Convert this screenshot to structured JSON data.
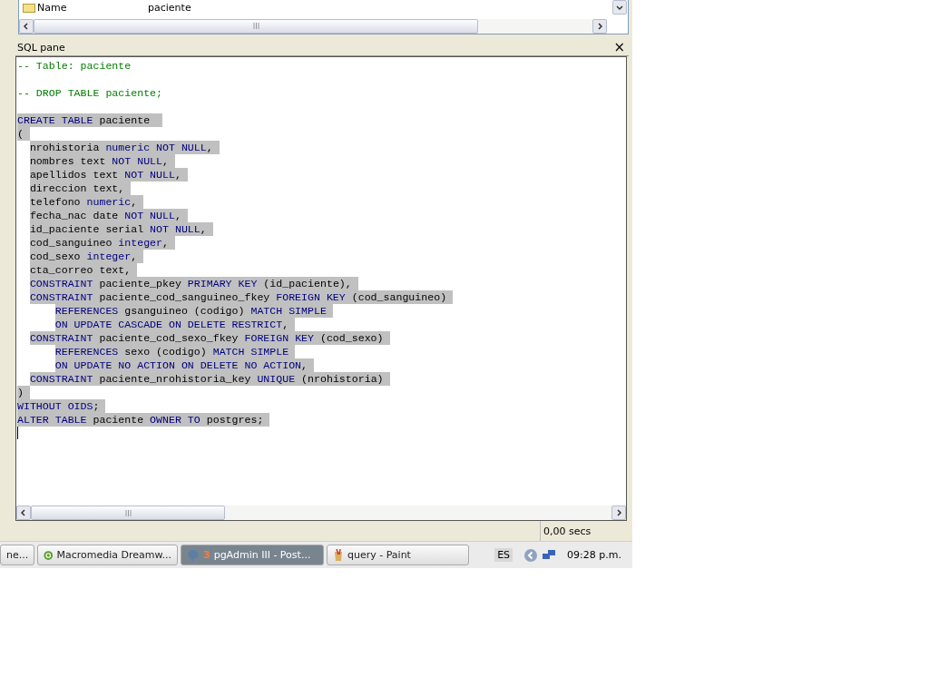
{
  "properties": {
    "rows": [
      {
        "name": "Name",
        "value": "paciente"
      }
    ]
  },
  "sql_pane": {
    "title": "SQL pane",
    "close": "×",
    "lines": [
      {
        "kind": "top",
        "selected": false,
        "segments": [
          {
            "kind": "comment",
            "text": "-- Table: paciente"
          }
        ]
      },
      {
        "kind": "blank",
        "selected": false
      },
      {
        "kind": "top",
        "selected": false,
        "segments": [
          {
            "kind": "comment",
            "text": "-- DROP TABLE paciente;"
          }
        ]
      },
      {
        "kind": "blank",
        "selected": false
      },
      {
        "kind": "top",
        "selected": true,
        "segments": [
          {
            "kind": "keyword",
            "text": "CREATE TABLE"
          },
          {
            "kind": "plain",
            "text": " paciente "
          }
        ]
      },
      {
        "kind": "top",
        "selected": true,
        "segments": [
          {
            "kind": "plain",
            "text": "("
          }
        ]
      },
      {
        "kind": "item",
        "selected": true,
        "segments": [
          {
            "kind": "plain",
            "text": "nrohistoria "
          },
          {
            "kind": "keyword",
            "text": "numeric NOT NULL"
          },
          {
            "kind": "plain",
            "text": ","
          }
        ]
      },
      {
        "kind": "item",
        "selected": true,
        "segments": [
          {
            "kind": "plain",
            "text": "nombres text "
          },
          {
            "kind": "keyword",
            "text": "NOT NULL"
          },
          {
            "kind": "plain",
            "text": ","
          }
        ]
      },
      {
        "kind": "item",
        "selected": true,
        "segments": [
          {
            "kind": "plain",
            "text": "apellidos text "
          },
          {
            "kind": "keyword",
            "text": "NOT NULL"
          },
          {
            "kind": "plain",
            "text": ","
          }
        ]
      },
      {
        "kind": "item",
        "selected": true,
        "segments": [
          {
            "kind": "plain",
            "text": "direccion text,"
          }
        ]
      },
      {
        "kind": "item",
        "selected": true,
        "segments": [
          {
            "kind": "plain",
            "text": "telefono "
          },
          {
            "kind": "keyword",
            "text": "numeric"
          },
          {
            "kind": "plain",
            "text": ","
          }
        ]
      },
      {
        "kind": "item",
        "selected": true,
        "segments": [
          {
            "kind": "plain",
            "text": "fecha_nac date "
          },
          {
            "kind": "keyword",
            "text": "NOT NULL"
          },
          {
            "kind": "plain",
            "text": ","
          }
        ]
      },
      {
        "kind": "item",
        "selected": true,
        "segments": [
          {
            "kind": "plain",
            "text": "id_paciente serial "
          },
          {
            "kind": "keyword",
            "text": "NOT NULL"
          },
          {
            "kind": "plain",
            "text": ","
          }
        ]
      },
      {
        "kind": "item",
        "selected": true,
        "segments": [
          {
            "kind": "plain",
            "text": "cod_sanguineo "
          },
          {
            "kind": "keyword",
            "text": "integer"
          },
          {
            "kind": "plain",
            "text": ","
          }
        ]
      },
      {
        "kind": "item",
        "selected": true,
        "segments": [
          {
            "kind": "plain",
            "text": "cod_sexo "
          },
          {
            "kind": "keyword",
            "text": "integer"
          },
          {
            "kind": "plain",
            "text": ","
          }
        ]
      },
      {
        "kind": "item",
        "selected": true,
        "segments": [
          {
            "kind": "plain",
            "text": "cta_correo text,"
          }
        ]
      },
      {
        "kind": "item",
        "selected": true,
        "segments": [
          {
            "kind": "keyword",
            "text": "CONSTRAINT"
          },
          {
            "kind": "plain",
            "text": " paciente_pkey "
          },
          {
            "kind": "keyword",
            "text": "PRIMARY KEY"
          },
          {
            "kind": "plain",
            "text": " (id_paciente),"
          }
        ]
      },
      {
        "kind": "item",
        "selected": true,
        "segments": [
          {
            "kind": "keyword",
            "text": "CONSTRAINT"
          },
          {
            "kind": "plain",
            "text": " paciente_cod_sanguineo_fkey "
          },
          {
            "kind": "keyword",
            "text": "FOREIGN KEY"
          },
          {
            "kind": "plain",
            "text": " (cod_sanguineo)"
          }
        ]
      },
      {
        "kind": "sub",
        "selected": true,
        "segments": [
          {
            "kind": "keyword",
            "text": "REFERENCES"
          },
          {
            "kind": "plain",
            "text": " gsanguineo (codigo) "
          },
          {
            "kind": "keyword",
            "text": "MATCH SIMPLE"
          }
        ]
      },
      {
        "kind": "sub",
        "selected": true,
        "segments": [
          {
            "kind": "keyword",
            "text": "ON UPDATE CASCADE ON DELETE RESTRICT"
          },
          {
            "kind": "plain",
            "text": ","
          }
        ]
      },
      {
        "kind": "item",
        "selected": true,
        "segments": [
          {
            "kind": "keyword",
            "text": "CONSTRAINT"
          },
          {
            "kind": "plain",
            "text": " paciente_cod_sexo_fkey "
          },
          {
            "kind": "keyword",
            "text": "FOREIGN KEY"
          },
          {
            "kind": "plain",
            "text": " (cod_sexo)"
          }
        ]
      },
      {
        "kind": "sub",
        "selected": true,
        "segments": [
          {
            "kind": "keyword",
            "text": "REFERENCES"
          },
          {
            "kind": "plain",
            "text": " sexo (codigo) "
          },
          {
            "kind": "keyword",
            "text": "MATCH SIMPLE"
          }
        ]
      },
      {
        "kind": "sub",
        "selected": true,
        "segments": [
          {
            "kind": "keyword",
            "text": "ON UPDATE NO ACTION ON DELETE NO ACTION"
          },
          {
            "kind": "plain",
            "text": ","
          }
        ]
      },
      {
        "kind": "item",
        "selected": true,
        "segments": [
          {
            "kind": "keyword",
            "text": "CONSTRAINT"
          },
          {
            "kind": "plain",
            "text": " paciente_nrohistoria_key "
          },
          {
            "kind": "keyword",
            "text": "UNIQUE"
          },
          {
            "kind": "plain",
            "text": " (nrohistoria)"
          }
        ]
      },
      {
        "kind": "top",
        "selected": true,
        "segments": [
          {
            "kind": "plain",
            "text": ")"
          }
        ]
      },
      {
        "kind": "top",
        "selected": true,
        "segments": [
          {
            "kind": "keyword",
            "text": "WITHOUT OIDS"
          },
          {
            "kind": "plain",
            "text": ";"
          }
        ]
      },
      {
        "kind": "top",
        "selected": true,
        "segments": [
          {
            "kind": "keyword",
            "text": "ALTER TABLE"
          },
          {
            "kind": "plain",
            "text": " paciente "
          },
          {
            "kind": "keyword",
            "text": "OWNER TO"
          },
          {
            "kind": "plain",
            "text": " postgres;"
          }
        ]
      }
    ]
  },
  "status_bar": {
    "time": "0,00 secs"
  },
  "taskbar": {
    "buttons": [
      {
        "kind": "plain",
        "label": "ne...",
        "selected": false
      },
      {
        "kind": "dreamweaver",
        "label": "Macromedia Dreamw...",
        "selected": false
      },
      {
        "kind": "pgadmin",
        "label": "pgAdmin III - Post...",
        "count": "3",
        "selected": true
      },
      {
        "kind": "paint",
        "label": "query - Paint",
        "selected": false
      }
    ],
    "language": "ES",
    "clock": "09:28 p.m."
  }
}
